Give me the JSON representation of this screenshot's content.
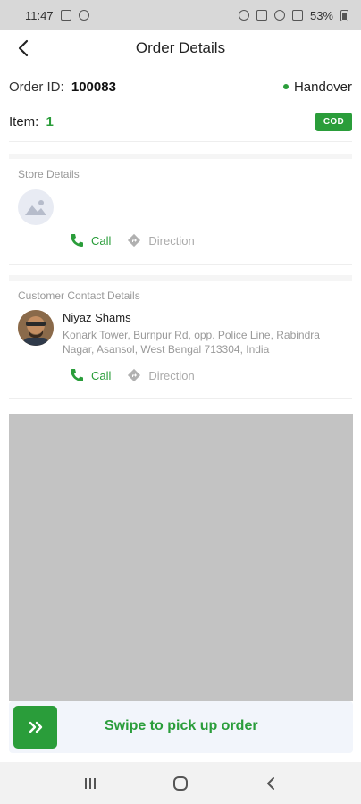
{
  "status_bar": {
    "time": "11:47",
    "battery": "53%"
  },
  "header": {
    "title": "Order Details",
    "back_icon": "back-arrow-icon"
  },
  "order": {
    "id_label": "Order ID:",
    "id_value": "100083",
    "status": "Handover",
    "status_color": "#2a9d3a",
    "item_label": "Item:",
    "item_value": "1",
    "payment_badge": "COD"
  },
  "store": {
    "section_label": "Store Details",
    "avatar_icon": "image-placeholder-icon",
    "call_label": "Call",
    "direction_label": "Direction"
  },
  "customer": {
    "section_label": "Customer Contact Details",
    "name": "Niyaz Shams",
    "address": "Konark Tower, Burnpur Rd, opp. Police Line, Rabindra Nagar, Asansol, West Bengal 713304, India",
    "call_label": "Call",
    "direction_label": "Direction"
  },
  "swipe": {
    "label": "Swipe to pick up order",
    "handle_icon": "double-chevron-right-icon"
  },
  "nav": {
    "recents_icon": "recents-icon",
    "home_icon": "home-icon",
    "back_icon": "nav-back-icon"
  },
  "colors": {
    "accent": "#2a9d3a",
    "map_placeholder": "#c3c3c3"
  }
}
